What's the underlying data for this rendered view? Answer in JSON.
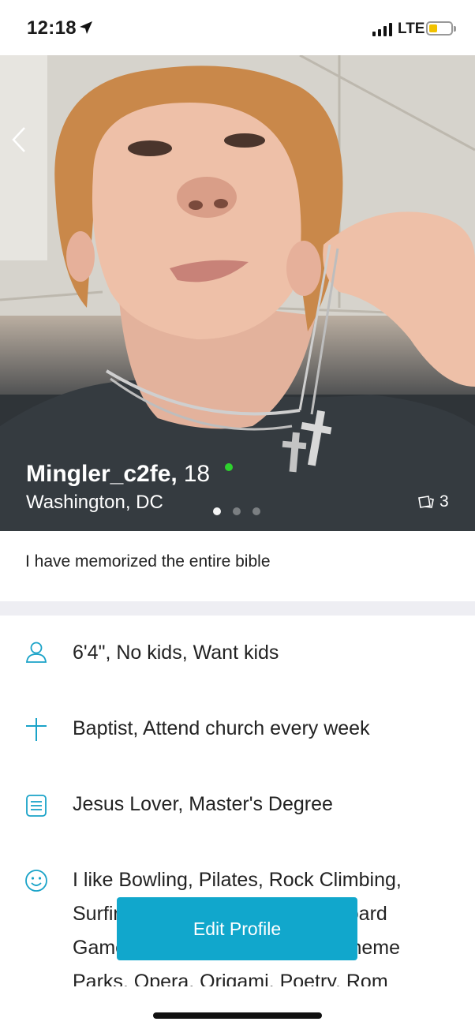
{
  "status_bar": {
    "time": "12:18",
    "network": "LTE",
    "battery_level": 0.25,
    "battery_color": "#f2c200"
  },
  "photo": {
    "back_icon": "chevron-left-icon",
    "current_photo_index": 1,
    "photo_total_dots": 3,
    "photo_count_icon": "photos-icon",
    "photo_count": "3"
  },
  "profile": {
    "username": "Mingler_c2fe,",
    "age": "18",
    "online": true,
    "online_color": "#2ed12e",
    "location": "Washington, DC",
    "headline": "I have memorized the entire bible"
  },
  "details": [
    {
      "icon": "person-icon",
      "text": "6'4\", No kids, Want kids"
    },
    {
      "icon": "cross-icon",
      "text": "Baptist, Attend church every week"
    },
    {
      "icon": "document-icon",
      "text": "Jesus Lover, Master's Degree"
    },
    {
      "icon": "smiley-icon",
      "text": "I like Bowling, Pilates, Rock Climbing, Surfing, Backpacking, Hiking, Board Games, Cards, Amusement & Theme Parks, Opera, Origami, Poetry, Rom"
    }
  ],
  "actions": {
    "edit_profile_label": "Edit Profile",
    "accent_color": "#11a7cc"
  }
}
